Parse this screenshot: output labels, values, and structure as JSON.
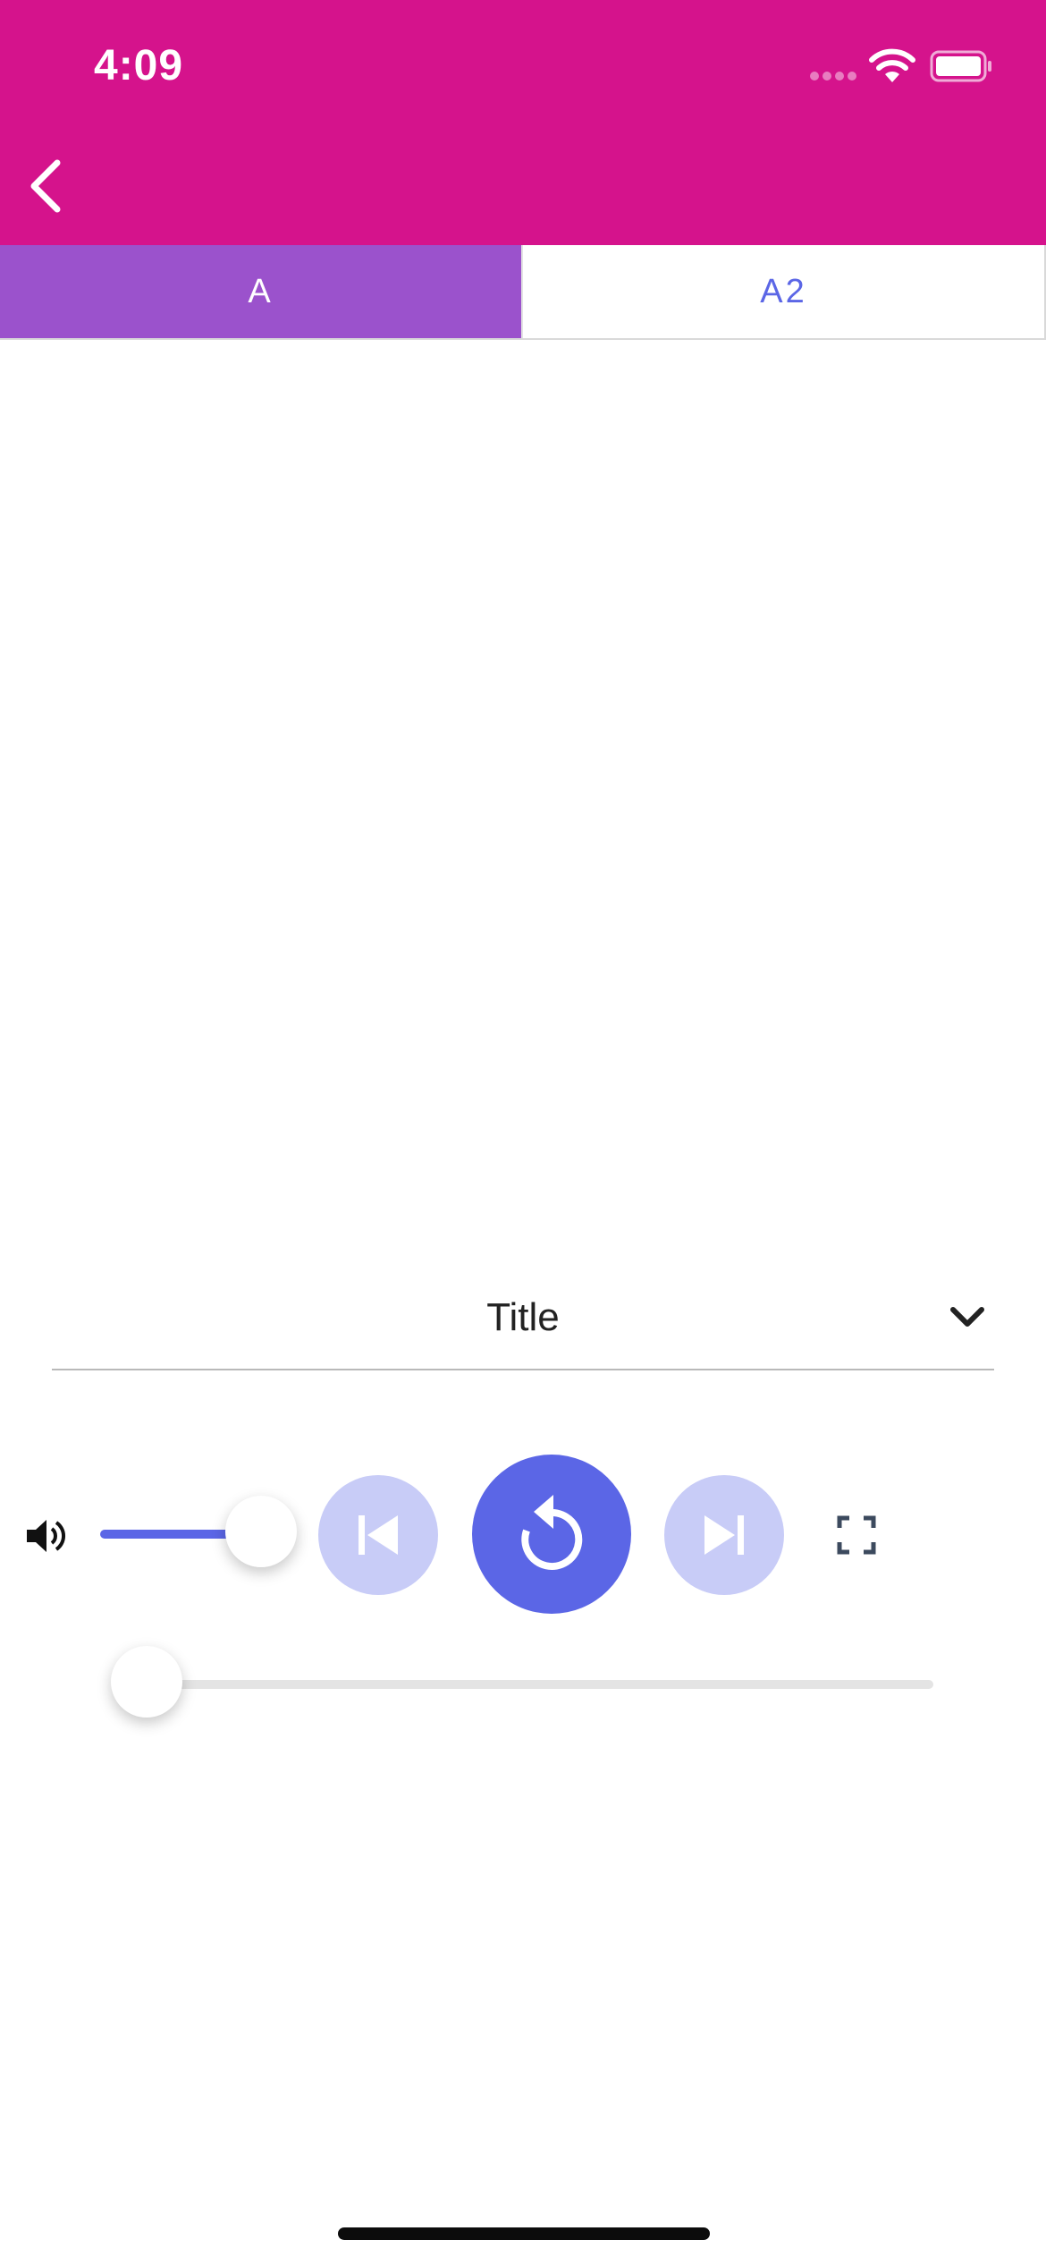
{
  "status_bar": {
    "time": "4:09"
  },
  "header": {
    "background_color": "#d5138c",
    "back_icon": "chevron-left-icon"
  },
  "tabs": [
    {
      "label": "A",
      "active": true,
      "color": "#9b52cc"
    },
    {
      "label": "A2",
      "active": false,
      "color": "#5b66e6"
    }
  ],
  "player": {
    "title": "Title",
    "dropdown_icon": "chevron-down-icon",
    "volume_icon": "volume-icon",
    "volume_level": 0.72,
    "prev_icon": "skip-previous-icon",
    "replay_icon": "replay-icon",
    "next_icon": "skip-next-icon",
    "fullscreen_icon": "fullscreen-icon",
    "progress": 0,
    "accent_color": "#5b66e6",
    "disabled_color": "#c8ccf7"
  }
}
